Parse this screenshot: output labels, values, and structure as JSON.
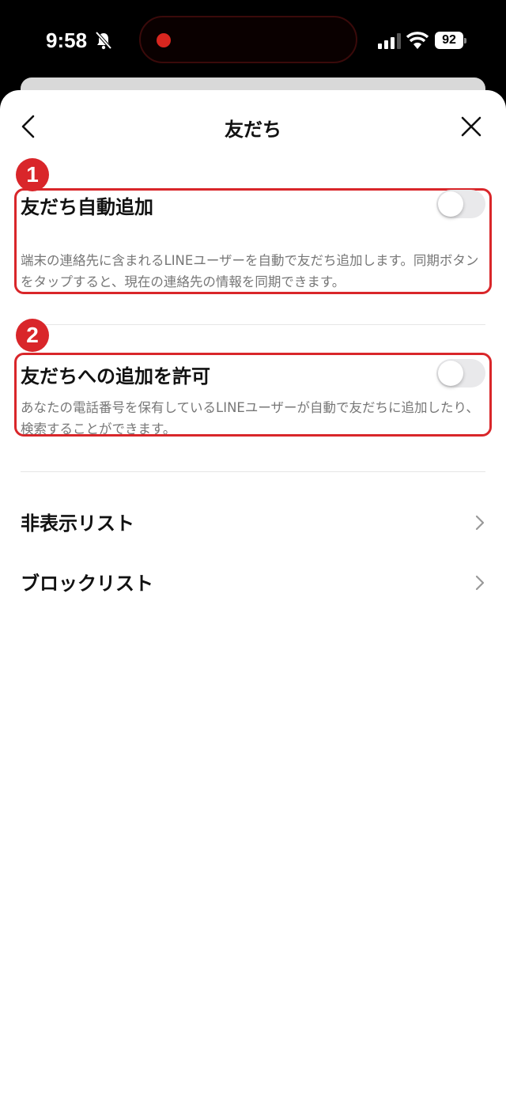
{
  "status_bar": {
    "time": "9:58",
    "battery": "92",
    "recording_color": "#d8261f",
    "icons": [
      "bell-slash-icon",
      "signal-icon",
      "wifi-icon",
      "battery-icon"
    ]
  },
  "header": {
    "title": "友だち",
    "back_icon": "chevron-left-icon",
    "close_icon": "close-icon"
  },
  "annotations": {
    "badge_1": "1",
    "badge_2": "2",
    "color": "#d9262a"
  },
  "settings": {
    "auto_add": {
      "title": "友だち自動追加",
      "description": "端末の連絡先に含まれるLINEユーザーを自動で友だち追加します。同期ボタンをタップすると、現在の連絡先の情報を同期できます。",
      "enabled": false
    },
    "allow_add": {
      "title": "友だちへの追加を許可",
      "description": "あなたの電話番号を保有しているLINEユーザーが自動で友だちに追加したり、検索することができます。",
      "enabled": false
    }
  },
  "list": {
    "hidden_list": "非表示リスト",
    "block_list": "ブロックリスト",
    "chevron_icon": "chevron-right-icon"
  }
}
